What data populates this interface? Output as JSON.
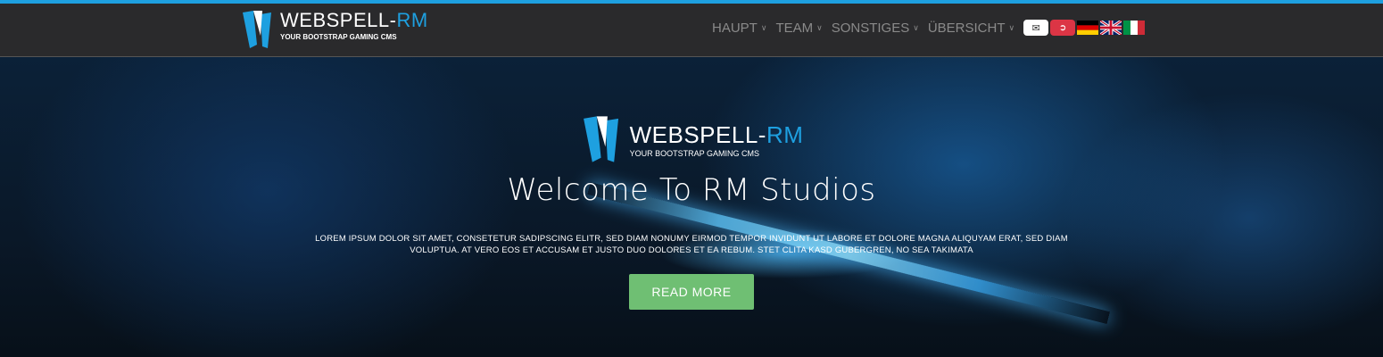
{
  "brand": {
    "name_main": "WEBSPELL-",
    "name_accent": "RM",
    "tagline": "YOUR BOOTSTRAP GAMING CMS",
    "accent_color": "#1ea0e0"
  },
  "nav": {
    "items": [
      {
        "label": "HAUPT"
      },
      {
        "label": "TEAM"
      },
      {
        "label": "SONSTIGES"
      },
      {
        "label": "ÜBERSICHT"
      }
    ],
    "icons": {
      "mail": "envelope-icon",
      "logout": "logout-icon"
    },
    "flags": [
      "german-flag",
      "uk-flag",
      "italian-flag"
    ]
  },
  "hero": {
    "title": "Welcome To RM Studios",
    "text": "LOREM IPSUM DOLOR SIT AMET, CONSETETUR SADIPSCING ELITR, SED DIAM NONUMY EIRMOD TEMPOR INVIDUNT UT LABORE ET DOLORE MAGNA ALIQUYAM ERAT, SED DIAM VOLUPTUA. AT VERO EOS ET ACCUSAM ET JUSTO DUO DOLORES ET EA REBUM. STET CLITA KASD GUBERGREN, NO SEA TAKIMATA",
    "button": "READ MORE",
    "button_color": "#6fbf73"
  }
}
